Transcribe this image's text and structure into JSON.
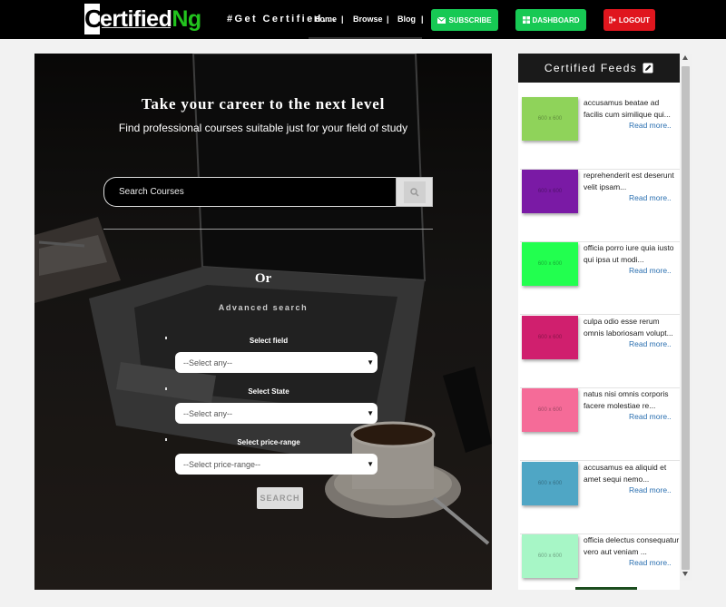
{
  "header": {
    "logo": {
      "c": "C",
      "rest": "ertified",
      "ng": "Ng"
    },
    "tagline": "#Get Certified...",
    "nav": [
      {
        "label": "Home"
      },
      {
        "label": "Browse"
      },
      {
        "label": "Blog"
      }
    ],
    "buttons": {
      "subscribe": "SUBSCRIBE",
      "dashboard": "DASHBOARD",
      "logout": "LOGOUT"
    }
  },
  "hero": {
    "title": "Take your career to the next level",
    "subtitle": "Find professional courses suitable just for your field of study",
    "search_placeholder": "Search Courses",
    "or": "Or",
    "advanced": "Advanced search",
    "fields": [
      {
        "label": "Select field",
        "value": "--Select any--"
      },
      {
        "label": "Select State",
        "value": "--Select any--"
      },
      {
        "label": "Select price-range",
        "value": "--Select price-range--"
      }
    ],
    "submit": "SEARCH"
  },
  "sidebar": {
    "title": "Certified Feeds",
    "feeds": [
      {
        "thumb_label": "600 x 600",
        "color": "#8fd35a",
        "text": "accusamus beatae ad facilis cum similique qui...",
        "more": "Read more.."
      },
      {
        "thumb_label": "600 x 600",
        "color": "#7a1aa5",
        "text": "reprehenderit est deserunt velit ipsam...",
        "more": "Read more.."
      },
      {
        "thumb_label": "600 x 600",
        "color": "#22ff4f",
        "text": "officia porro iure quia iusto qui ipsa ut modi...",
        "more": "Read more.."
      },
      {
        "thumb_label": "600 x 600",
        "color": "#d01f6e",
        "text": "culpa odio esse rerum omnis laboriosam volupt...",
        "more": "Read more.."
      },
      {
        "thumb_label": "600 x 600",
        "color": "#f56b98",
        "text": "natus nisi omnis corporis facere molestiae re...",
        "more": "Read more.."
      },
      {
        "thumb_label": "600 x 600",
        "color": "#4fa6c5",
        "text": "accusamus ea aliquid et amet sequi nemo...",
        "more": "Read more.."
      },
      {
        "thumb_label": "600 x 600",
        "color": "#a7f6c6",
        "text": "officia delectus consequatur vero aut veniam ...",
        "more": "Read more.."
      }
    ]
  }
}
